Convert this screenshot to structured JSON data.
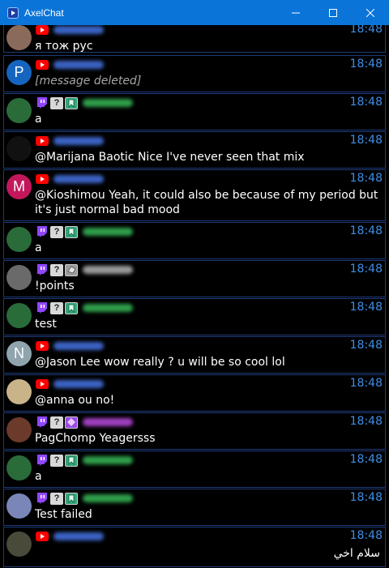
{
  "window": {
    "title": "AxelChat",
    "minimize_icon": "minimize-icon",
    "maximize_icon": "maximize-icon",
    "close_icon": "close-icon"
  },
  "colors": {
    "titlebar": "#0a74d8",
    "timestamp": "#3d8ee6",
    "border": "#1e3a78",
    "youtube": "#ff0000",
    "twitch": "#9146ff"
  },
  "messages": [
    {
      "platform": "youtube",
      "avatar_letter": "",
      "avatar_color": "#8a6a5a",
      "badges": [],
      "name_color": "#3b63c4",
      "time": "18:48",
      "text": "я тож рус",
      "deleted": false,
      "rtl": false
    },
    {
      "platform": "youtube",
      "avatar_letter": "P",
      "avatar_color": "#1565c0",
      "badges": [],
      "name_color": "#3b63c4",
      "time": "18:48",
      "text": "[message deleted]",
      "deleted": true,
      "rtl": false
    },
    {
      "platform": "twitch",
      "avatar_letter": "",
      "avatar_color": "#2a6b3a",
      "badges": [
        "question",
        "subscriber"
      ],
      "name_color": "#2e9e4a",
      "time": "18:48",
      "text": "a",
      "deleted": false,
      "rtl": false
    },
    {
      "platform": "youtube",
      "avatar_letter": "",
      "avatar_color": "#111",
      "badges": [],
      "name_color": "#3b63c4",
      "time": "18:48",
      "text": "@Marijana Baotic Nice I've never seen that mix",
      "deleted": false,
      "rtl": false
    },
    {
      "platform": "youtube",
      "avatar_letter": "M",
      "avatar_color": "#c2185b",
      "badges": [],
      "name_color": "#3b63c4",
      "time": "18:48",
      "text": "@Kioshimou Yeah, it could also be because of my period but it's just normal bad mood",
      "deleted": false,
      "rtl": false
    },
    {
      "platform": "twitch",
      "avatar_letter": "",
      "avatar_color": "#2a6b3a",
      "badges": [
        "question",
        "subscriber"
      ],
      "name_color": "#2e9e4a",
      "time": "18:48",
      "text": "a",
      "deleted": false,
      "rtl": false
    },
    {
      "platform": "twitch",
      "avatar_letter": "",
      "avatar_color": "#6a6a6a",
      "badges": [
        "question",
        "bits"
      ],
      "name_color": "#9a9a9a",
      "time": "18:48",
      "text": "!points",
      "deleted": false,
      "rtl": false
    },
    {
      "platform": "twitch",
      "avatar_letter": "",
      "avatar_color": "#2a6b3a",
      "badges": [
        "question",
        "subscriber"
      ],
      "name_color": "#2e9e4a",
      "time": "18:48",
      "text": "test",
      "deleted": false,
      "rtl": false
    },
    {
      "platform": "youtube",
      "avatar_letter": "N",
      "avatar_color": "#90a4ae",
      "badges": [],
      "name_color": "#3b63c4",
      "time": "18:48",
      "text": "@Jason Lee wow really ? u will be so cool lol",
      "deleted": false,
      "rtl": false
    },
    {
      "platform": "youtube",
      "avatar_letter": "",
      "avatar_color": "#c9b48a",
      "badges": [],
      "name_color": "#3b63c4",
      "time": "18:48",
      "text": "@anna ou no!",
      "deleted": false,
      "rtl": false
    },
    {
      "platform": "twitch",
      "avatar_letter": "",
      "avatar_color": "#6b3a2a",
      "badges": [
        "question",
        "purple-sub"
      ],
      "name_color": "#a040c0",
      "time": "18:48",
      "text": "PagChomp Yeagersss",
      "deleted": false,
      "rtl": false
    },
    {
      "platform": "twitch",
      "avatar_letter": "",
      "avatar_color": "#2a6b3a",
      "badges": [
        "question",
        "subscriber"
      ],
      "name_color": "#2e9e4a",
      "time": "18:48",
      "text": "a",
      "deleted": false,
      "rtl": false
    },
    {
      "platform": "twitch",
      "avatar_letter": "",
      "avatar_color": "#7a86b8",
      "badges": [
        "question",
        "subscriber"
      ],
      "name_color": "#2e9e4a",
      "time": "18:48",
      "text": "Test failed",
      "deleted": false,
      "rtl": false
    },
    {
      "platform": "youtube",
      "avatar_letter": "",
      "avatar_color": "#4a4a3a",
      "badges": [],
      "name_color": "#3b63c4",
      "time": "18:48",
      "text": "سلام اخي",
      "deleted": false,
      "rtl": true
    }
  ]
}
